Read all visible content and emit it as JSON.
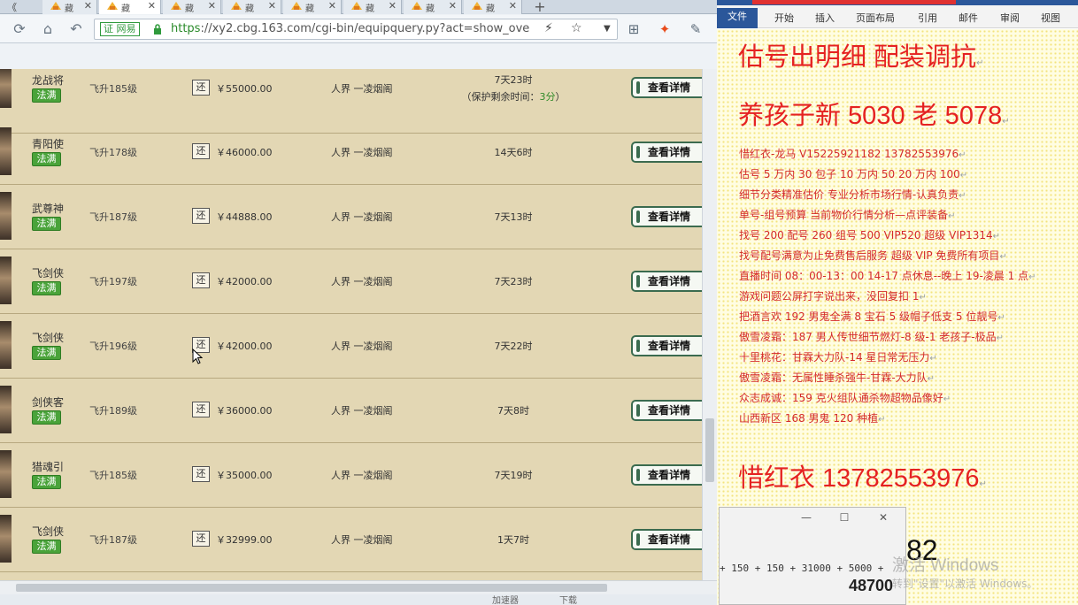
{
  "browser": {
    "tabs": [
      {
        "label": "藏"
      },
      {
        "label": "藏"
      },
      {
        "label": "藏"
      },
      {
        "label": "藏"
      },
      {
        "label": "藏"
      },
      {
        "label": "藏"
      },
      {
        "label": "藏"
      },
      {
        "label": "藏"
      }
    ],
    "back_tab_label": "《",
    "close_glyph": "✕",
    "new_tab": "+",
    "cert_label": "证 网易",
    "url_scheme": "https",
    "url_rest": "://xy2.cbg.163.com/cgi-bin/equipquery.py?act=show_ove",
    "status_items": [
      "加速器",
      "下载"
    ]
  },
  "listings": [
    {
      "name": "龙战将",
      "tag": "法满",
      "level": "飞升185级",
      "haggle": "还",
      "price": "￥55000.00",
      "server": "人界  一凌烟阁",
      "time": "7天23时",
      "note_prefix": "（保护剩余时间：",
      "note_value": "3分",
      "note_suffix": "）",
      "detail": "查看详情"
    },
    {
      "name": "青阳使",
      "tag": "法满",
      "level": "飞升178级",
      "haggle": "还",
      "price": "￥46000.00",
      "server": "人界  一凌烟阁",
      "time": "14天6时",
      "detail": "查看详情"
    },
    {
      "name": "武尊神",
      "tag": "法满",
      "level": "飞升187级",
      "haggle": "还",
      "price": "￥44888.00",
      "server": "人界  一凌烟阁",
      "time": "7天13时",
      "detail": "查看详情"
    },
    {
      "name": "飞剑侠",
      "tag": "法满",
      "level": "飞升197级",
      "haggle": "还",
      "price": "￥42000.00",
      "server": "人界  一凌烟阁",
      "time": "7天23时",
      "detail": "查看详情"
    },
    {
      "name": "飞剑侠",
      "tag": "法满",
      "level": "飞升196级",
      "haggle": "还",
      "price": "￥42000.00",
      "server": "人界  一凌烟阁",
      "time": "7天22时",
      "detail": "查看详情"
    },
    {
      "name": "剑侠客",
      "tag": "法满",
      "level": "飞升189级",
      "haggle": "还",
      "price": "￥36000.00",
      "server": "人界  一凌烟阁",
      "time": "7天8时",
      "detail": "查看详情"
    },
    {
      "name": "猎魂引",
      "tag": "法满",
      "level": "飞升185级",
      "haggle": "还",
      "price": "￥35000.00",
      "server": "人界  一凌烟阁",
      "time": "7天19时",
      "detail": "查看详情"
    },
    {
      "name": "飞剑侠",
      "tag": "法满",
      "level": "飞升187级",
      "haggle": "还",
      "price": "￥32999.00",
      "server": "人界  一凌烟阁",
      "time": "1天7时",
      "detail": "查看详情"
    }
  ],
  "word": {
    "menu": {
      "file": "文件",
      "items": [
        "开始",
        "插入",
        "页面布局",
        "引用",
        "邮件",
        "审阅",
        "视图"
      ]
    },
    "heading1": "估号出明细  配装调抗",
    "heading2": "养孩子新 5030 老 5078",
    "lines": [
      "惜红衣-龙马 V15225921182    13782553976",
      "估号 5 万内 30 包子  10 万内 50  20 万内 100",
      "细节分类精准估价  专业分析市场行情-认真负责",
      "单号-组号预算    当前物价行情分析—点评装备",
      "找号 200    配号 260    组号 500  VIP520    超级  VIP1314",
      "找号配号满意为止免费售后服务    超级  VIP 免费所有项目",
      "直播时间 08：00-13：00  14-17 点休息--晚上 19-凌晨 1 点",
      "游戏问题公屏打字说出来，没回复扣 1",
      "把酒言欢 192 男鬼全满 8 宝石 5 级帽子低支 5 位靓号",
      "傲雪凌霜：187 男人传世细节燃灯-8 级-1 老孩子-极品",
      "十里桃花：甘霖大力队-14 星日常无压力",
      "傲雪凌霜：无属性睡杀强牛-甘霖-大力队",
      "众志成诚：159 克火组队通杀物超物品像好",
      "山西新区 168 男鬼 120 种植"
    ],
    "heading3": "惜红衣 13782553976",
    "para_mark": "↵"
  },
  "calculator": {
    "expression": "+ 150 + 150 + 31000 + 5000 +",
    "result": "48700",
    "min": "—",
    "max": "☐",
    "close": "✕"
  },
  "overlay": {
    "big_number": "82",
    "watermark_title": "激活 Windows",
    "watermark_sub": "转到\"设置\"以激活 Windows。"
  }
}
